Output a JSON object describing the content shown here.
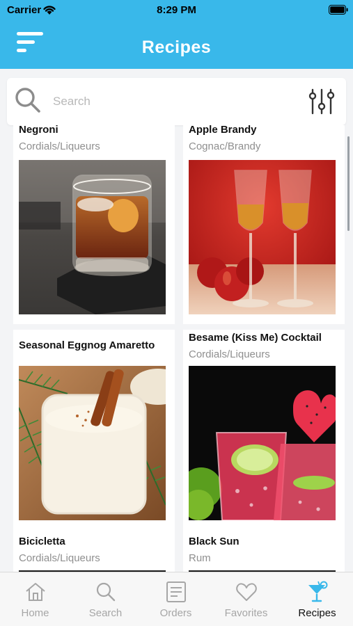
{
  "status_bar": {
    "carrier": "Carrier",
    "time": "8:29 PM"
  },
  "header": {
    "title": "Recipes"
  },
  "search": {
    "placeholder": "Search"
  },
  "recipes": [
    {
      "name": "Negroni",
      "category": "Cordials/Liqueurs",
      "image": "negroni-cocktail-image"
    },
    {
      "name": "Apple Brandy",
      "category": "Cognac/Brandy",
      "image": "apple-brandy-glasses-image"
    },
    {
      "name": "Seasonal Eggnog Amaretto",
      "category": "",
      "image": "eggnog-cinnamon-image"
    },
    {
      "name": "Besame (Kiss Me) Cocktail",
      "category": "Cordials/Liqueurs",
      "image": "watermelon-heart-cocktail-image"
    },
    {
      "name": "Bicicletta",
      "category": "Cordials/Liqueurs"
    },
    {
      "name": "Black Sun",
      "category": "Rum"
    }
  ],
  "tabs": [
    {
      "label": "Home",
      "icon": "home-icon"
    },
    {
      "label": "Search",
      "icon": "search-icon"
    },
    {
      "label": "Orders",
      "icon": "orders-icon"
    },
    {
      "label": "Favorites",
      "icon": "heart-icon"
    },
    {
      "label": "Recipes",
      "icon": "cocktail-icon",
      "active": true
    }
  ],
  "colors": {
    "header": "#39b8ea",
    "active_tab_icon": "#39b8ea",
    "inactive_tab": "#a6a6a6"
  }
}
